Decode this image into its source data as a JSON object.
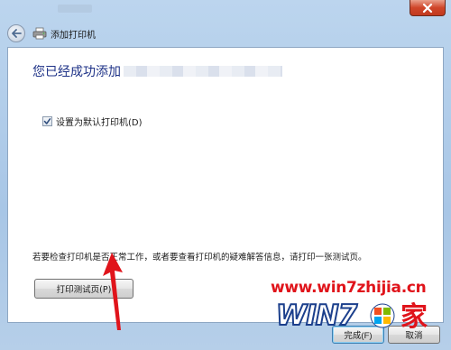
{
  "window": {
    "close_icon": "close-icon",
    "accent": "#c13a1f"
  },
  "nav": {
    "back_icon": "back-arrow-icon",
    "printer_icon": "printer-icon",
    "title": "添加打印机"
  },
  "content": {
    "heading": "您已经成功添加",
    "default_printer_checkbox": {
      "label": "设置为默认打印机(D)",
      "checked": true
    },
    "info_text": "若要检查打印机是否正常工作，或者要查看打印机的疑难解答信息，请打印一张测试页。",
    "test_page_button": "打印测试页(P)"
  },
  "footer": {
    "finish_button": "完成(F)",
    "cancel_button": "取消"
  },
  "watermark": {
    "url": "www.win7zhijia.cn",
    "logo_text": "WIN7",
    "logo_suffix": "家",
    "color": "#e0141b"
  }
}
